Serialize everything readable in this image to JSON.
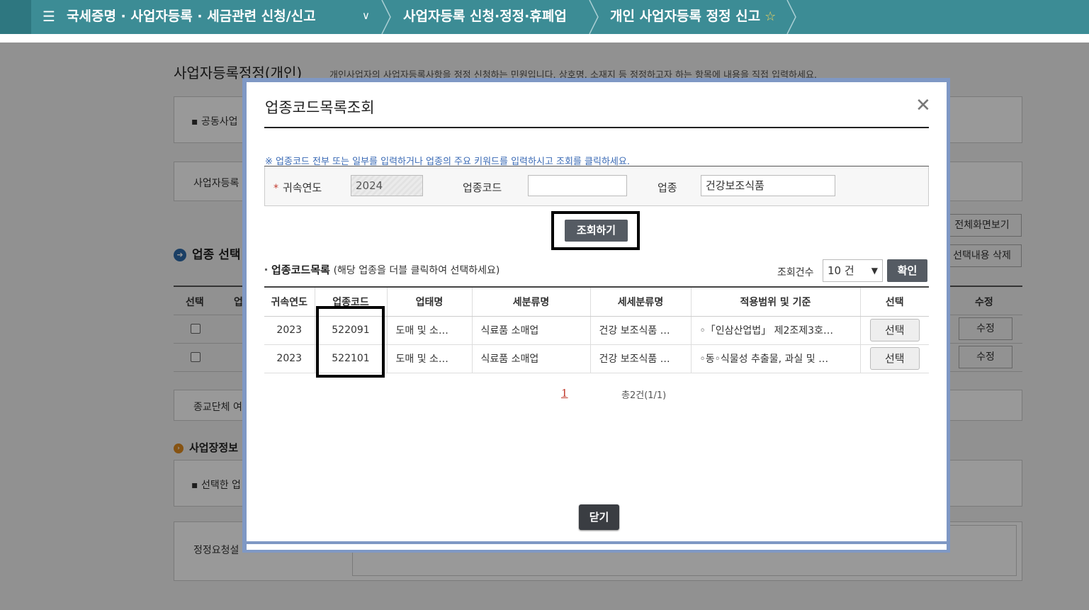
{
  "breadcrumb": {
    "menu_icon": "hamburger-menu-icon",
    "level1": "국세증명 · 사업자등록 · 세금관련 신청/신고",
    "level2": "사업자등록 신청·정정·휴폐업",
    "level3": "개인 사업자등록 정정 신고",
    "favorite_icon": "star-outline-icon"
  },
  "background_page": {
    "title": "사업자등록정정(개인)",
    "description": "개인사업자의 사업자등록사항을 정정 신청하는 민원입니다. 상호명, 소재지 등 정정하고자 하는 항목에 내용을 직접 입력하세요.",
    "joint_business_label": "공동사업",
    "business_reg_label": "사업자등록",
    "full_screen_button": "전체화면보기",
    "section_industry": "업종 선택",
    "delete_selected_button": "선택내용 삭제",
    "table_headers": [
      "선택",
      "업",
      "수정"
    ],
    "edit_button": "수정",
    "religious_label": "종교단체 여",
    "section_business_info": "사업장정보",
    "selected_industry_label": "선택한 업",
    "correction_reason_label": "정정요청설"
  },
  "modal": {
    "title": "업종코드목록조회",
    "close_icon": "close-x-icon",
    "notice": "※ 업종코드 전부 또는 일부를 입력하거나 업종의 주요 키워드를 입력하시고 조회를 클릭하세요.",
    "search": {
      "year_label": "귀속연도",
      "year_value": "2024",
      "code_label": "업종코드",
      "code_value": "",
      "industry_label": "업종",
      "industry_value": "건강보조식품",
      "search_button": "조회하기"
    },
    "list_title": "업종코드목록",
    "list_subtitle": "(해당 업종을 더블 클릭하여 선택하세요)",
    "count_label": "조회건수",
    "count_value": "10 건",
    "confirm_button": "확인",
    "table": {
      "headers": [
        "귀속연도",
        "업종코드",
        "업태명",
        "세분류명",
        "세세분류명",
        "적용범위 및 기준",
        "선택"
      ],
      "rows": [
        {
          "year": "2023",
          "code": "522091",
          "business_type": "도매 및 소…",
          "subclass": "식료품 소매업",
          "detail_class": "건강 보조식품 …",
          "scope": "◦「인삼산업법」 제2조제3호…",
          "select_label": "선택"
        },
        {
          "year": "2023",
          "code": "522101",
          "business_type": "도매 및 소…",
          "subclass": "식료품 소매업",
          "detail_class": "건강 보조식품 …",
          "scope": "◦동◦식물성 추출물, 과실 및 …",
          "select_label": "선택"
        }
      ]
    },
    "pager": {
      "current_page": "1",
      "total_text": "총2건(1/1)"
    },
    "close_button": "닫기"
  }
}
